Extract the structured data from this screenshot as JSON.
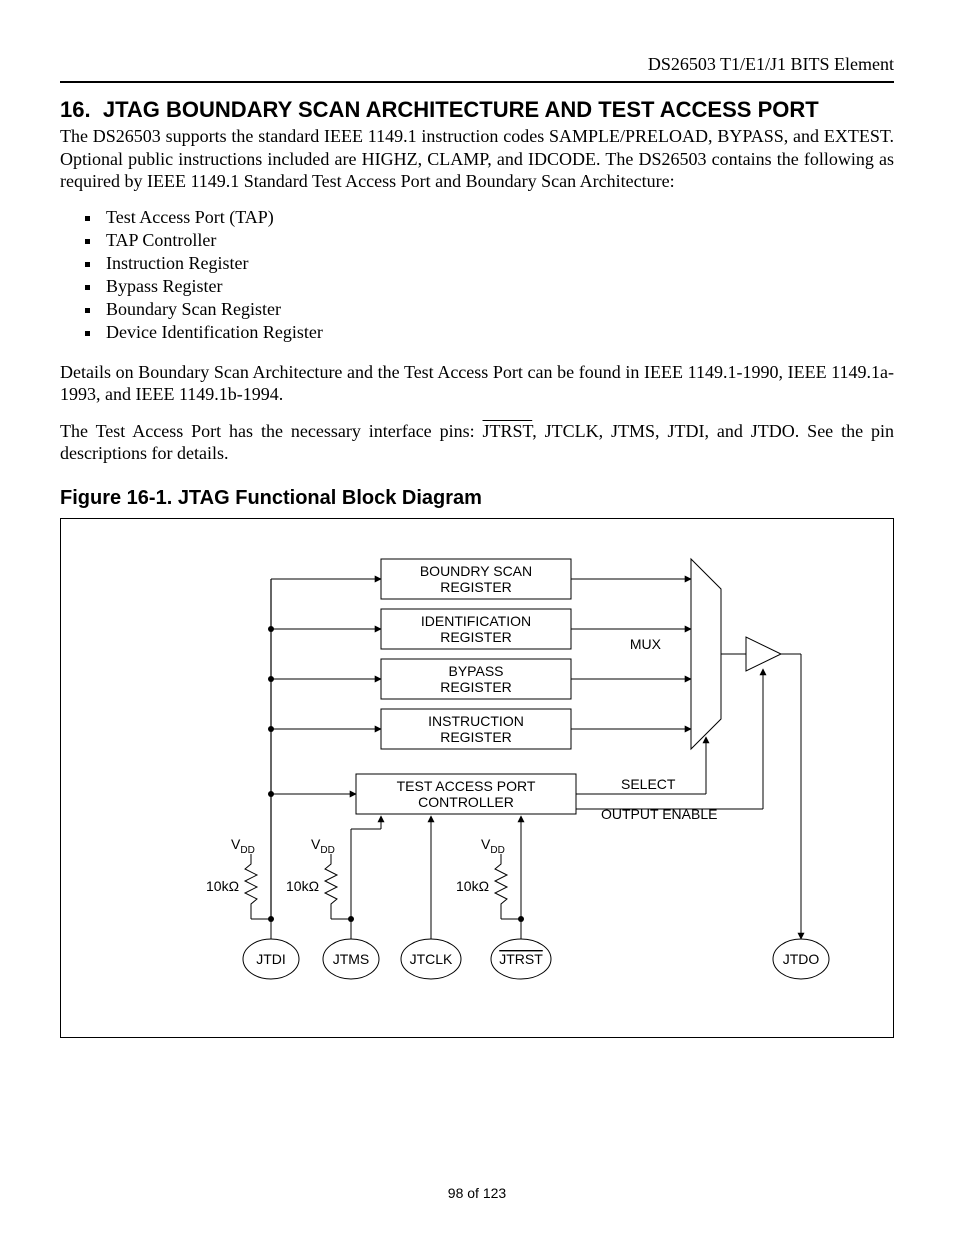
{
  "header": {
    "running_head": "DS26503 T1/E1/J1 BITS Element"
  },
  "section": {
    "number": "16.",
    "title": "JTAG BOUNDARY SCAN ARCHITECTURE AND TEST ACCESS PORT"
  },
  "paragraphs": {
    "intro": "The DS26503 supports the standard IEEE 1149.1 instruction codes SAMPLE/PRELOAD, BYPASS, and EXTEST. Optional public instructions included are HIGHZ, CLAMP, and IDCODE. The DS26503 contains the following as required by IEEE 1149.1 Standard Test Access Port and Boundary Scan Architecture:",
    "details": "Details on Boundary Scan Architecture and the Test Access Port can be found in IEEE 1149.1-1990, IEEE 1149.1a-1993, and IEEE 1149.1b-1994.",
    "tap_pre": "The Test Access Port has the necessary interface pins: ",
    "tap_pin_over": "JTRST",
    "tap_post": ", JTCLK, JTMS, JTDI, and JTDO. See the pin descriptions for details."
  },
  "bullets": [
    "Test Access Port (TAP)",
    "TAP Controller",
    "Instruction Register",
    "Bypass Register",
    "Boundary Scan Register",
    "Device Identification Register"
  ],
  "figure": {
    "caption": "Figure 16-1. JTAG Functional Block Diagram",
    "blocks": {
      "boundary1": "BOUNDRY SCAN",
      "boundary2": "REGISTER",
      "ident1": "IDENTIFICATION",
      "ident2": "REGISTER",
      "bypass1": "BYPASS",
      "bypass2": "REGISTER",
      "instr1": "INSTRUCTION",
      "instr2": "REGISTER",
      "tap1": "TEST ACCESS PORT",
      "tap2": "CONTROLLER",
      "mux": "MUX",
      "select": "SELECT",
      "outen": "OUTPUT ENABLE"
    },
    "labels": {
      "vdd": "V",
      "vdd_sub": "DD",
      "res": "10kΩ"
    },
    "pins": {
      "jtdi": "JTDI",
      "jtms": "JTMS",
      "jtclk": "JTCLK",
      "jtrst": "JTRST",
      "jtdo": "JTDO"
    }
  },
  "footer": {
    "page": "98 of 123"
  }
}
